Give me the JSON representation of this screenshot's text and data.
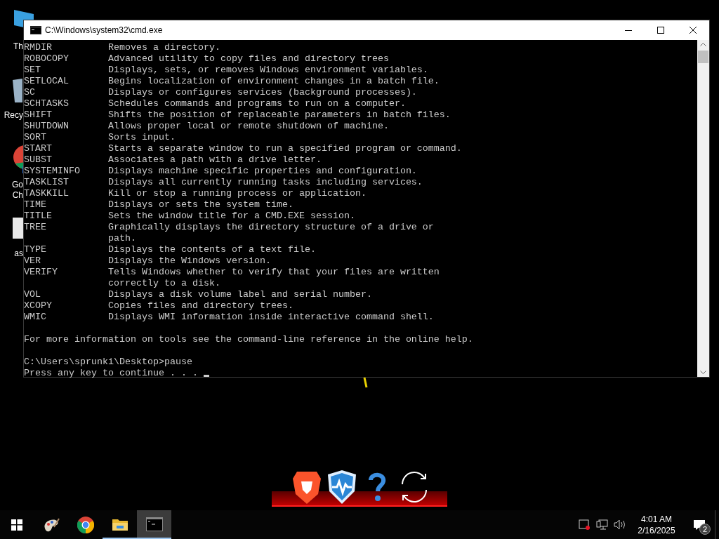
{
  "desktop_icons": [
    {
      "labels": [
        "Th"
      ]
    },
    {
      "labels": [
        "Recy"
      ]
    },
    {
      "labels": [
        "Go",
        "Ch"
      ]
    },
    {
      "labels": [
        "as"
      ]
    }
  ],
  "window": {
    "title": "C:\\Windows\\system32\\cmd.exe",
    "console_lines": [
      "RMDIR          Removes a directory.",
      "ROBOCOPY       Advanced utility to copy files and directory trees",
      "SET            Displays, sets, or removes Windows environment variables.",
      "SETLOCAL       Begins localization of environment changes in a batch file.",
      "SC             Displays or configures services (background processes).",
      "SCHTASKS       Schedules commands and programs to run on a computer.",
      "SHIFT          Shifts the position of replaceable parameters in batch files.",
      "SHUTDOWN       Allows proper local or remote shutdown of machine.",
      "SORT           Sorts input.",
      "START          Starts a separate window to run a specified program or command.",
      "SUBST          Associates a path with a drive letter.",
      "SYSTEMINFO     Displays machine specific properties and configuration.",
      "TASKLIST       Displays all currently running tasks including services.",
      "TASKKILL       Kill or stop a running process or application.",
      "TIME           Displays or sets the system time.",
      "TITLE          Sets the window title for a CMD.EXE session.",
      "TREE           Graphically displays the directory structure of a drive or",
      "               path.",
      "TYPE           Displays the contents of a text file.",
      "VER            Displays the Windows version.",
      "VERIFY         Tells Windows whether to verify that your files are written",
      "               correctly to a disk.",
      "VOL            Displays a disk volume label and serial number.",
      "XCOPY          Copies files and directory trees.",
      "WMIC           Displays WMI information inside interactive command shell."
    ],
    "console_blocks": [
      [
        "For more information on tools see the command-line reference in the online help."
      ],
      [
        "C:\\Users\\sprunki\\Desktop>pause",
        "Press any key to continue . . . "
      ]
    ]
  },
  "taskbar": {
    "apps": [
      {
        "kind": "paint",
        "selected": false
      },
      {
        "kind": "chrome",
        "selected": false
      },
      {
        "kind": "folder",
        "selected": false
      },
      {
        "kind": "cmd",
        "selected": true
      }
    ],
    "time": "4:01 AM",
    "date": "2/16/2025",
    "notification_count": "2"
  }
}
